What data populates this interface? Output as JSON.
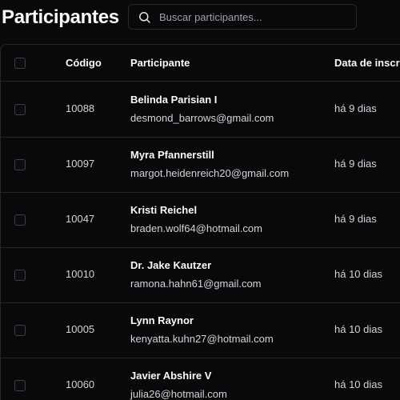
{
  "page": {
    "title": "Participantes"
  },
  "search": {
    "placeholder": "Buscar participantes...",
    "value": ""
  },
  "table": {
    "columns": {
      "code": "Código",
      "participant": "Participante",
      "date": "Data de inscr"
    },
    "rows": [
      {
        "code": "10088",
        "name": "Belinda Parisian I",
        "email": "desmond_barrows@gmail.com",
        "date": "há 9 dias"
      },
      {
        "code": "10097",
        "name": "Myra Pfannerstill",
        "email": "margot.heidenreich20@gmail.com",
        "date": "há 9 dias"
      },
      {
        "code": "10047",
        "name": "Kristi Reichel",
        "email": "braden.wolf64@hotmail.com",
        "date": "há 9 dias"
      },
      {
        "code": "10010",
        "name": "Dr. Jake Kautzer",
        "email": "ramona.hahn61@gmail.com",
        "date": "há 10 dias"
      },
      {
        "code": "10005",
        "name": "Lynn Raynor",
        "email": "kenyatta.kuhn27@hotmail.com",
        "date": "há 10 dias"
      },
      {
        "code": "10060",
        "name": "Javier Abshire V",
        "email": "julia26@hotmail.com",
        "date": "há 10 dias"
      }
    ]
  },
  "colors": {
    "background": "#09090b",
    "border": "#27272a",
    "text": "#fafafa",
    "muted": "#a1a1aa"
  }
}
